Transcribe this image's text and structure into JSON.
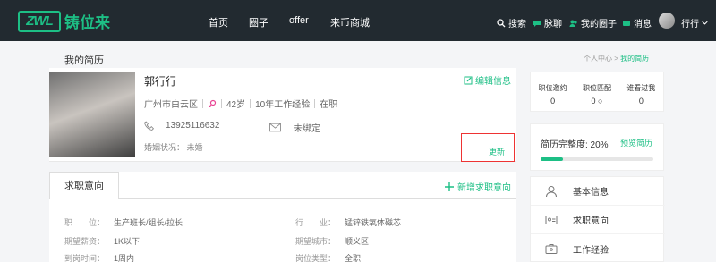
{
  "brand": {
    "logo": "ZWL",
    "name": "铸位来"
  },
  "nav": {
    "items": [
      "首页",
      "圈子",
      "offer",
      "来币商城"
    ]
  },
  "nav_right": {
    "search": "搜索",
    "chat": "脉聊",
    "my_circle": "我的圈子",
    "messages": "消息",
    "user": "行行"
  },
  "page": {
    "title": "我的简历"
  },
  "breadcrumb": {
    "home": "个人中心",
    "sep": ">",
    "current": "我的简历"
  },
  "profile": {
    "name": "郭行行",
    "edit_label": "编辑信息",
    "location": "广州市白云区",
    "gender_icon": "female-icon",
    "age": "42岁",
    "experience": "10年工作经验",
    "status": "在职",
    "phone": "13925116632",
    "email": "未绑定",
    "marital": "婚姻状况： 未婚",
    "update_label": "更新"
  },
  "stats": [
    {
      "label": "职位邀约",
      "value": "0"
    },
    {
      "label": "职位匹配",
      "value": "0 ○"
    },
    {
      "label": "谁看过我",
      "value": "0"
    }
  ],
  "completeness": {
    "label": "简历完整度: 20%",
    "percent": 20,
    "preview": "预览简历"
  },
  "intent": {
    "tab": "求职意向",
    "add_label": "新增求职意向",
    "fields": [
      {
        "key": "职　　位：",
        "value": "生产班长/组长/拉长"
      },
      {
        "key": "行　　业：",
        "value": "锰锌铁氧体磁芯"
      },
      {
        "key": "期望薪资：",
        "value": "1K以下"
      },
      {
        "key": "期望城市：",
        "value": "顺义区"
      },
      {
        "key": "到岗时间：",
        "value": "1周内"
      },
      {
        "key": "岗位类型：",
        "value": "全职"
      }
    ]
  },
  "menu": [
    {
      "label": "基本信息",
      "icon": "user-icon"
    },
    {
      "label": "求职意向",
      "icon": "id-card-icon"
    },
    {
      "label": "工作经验",
      "icon": "briefcase-icon"
    }
  ],
  "colors": {
    "accent": "#1dbf85",
    "topbar": "#222a30",
    "highlight": "#e33333"
  }
}
